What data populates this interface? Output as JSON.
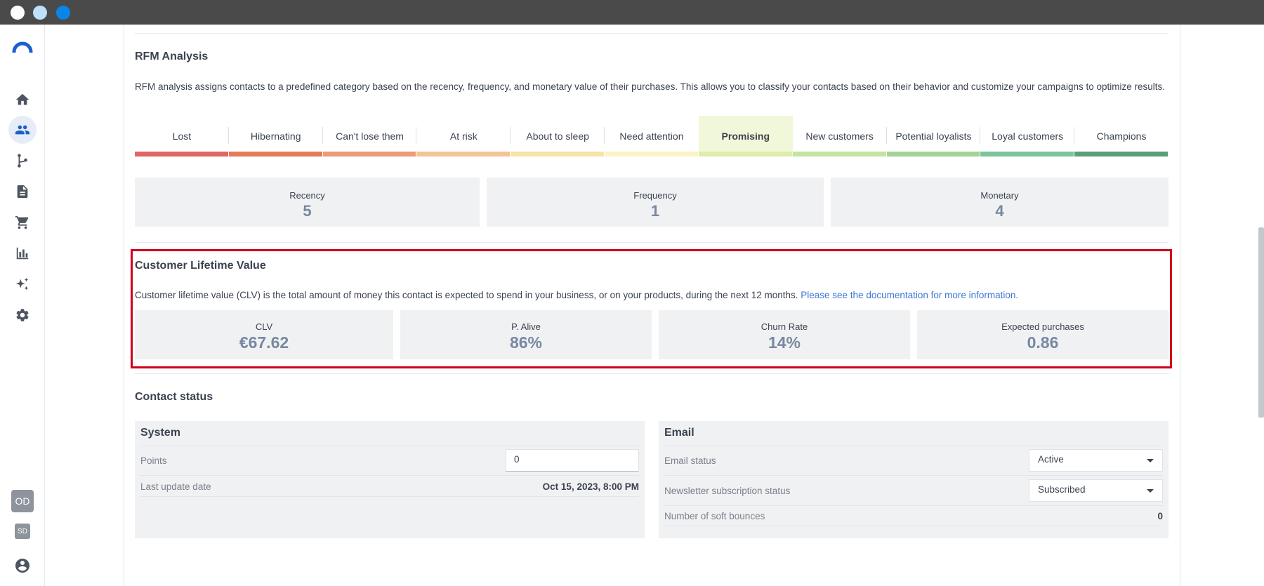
{
  "window": {
    "title_dots": [
      "close",
      "minimize",
      "maximize"
    ]
  },
  "sidebar": {
    "items": [
      {
        "icon": "home-icon",
        "active": false
      },
      {
        "icon": "contacts-icon",
        "active": true
      },
      {
        "icon": "workflow-icon",
        "active": false
      },
      {
        "icon": "document-icon",
        "active": false
      },
      {
        "icon": "cart-icon",
        "active": false
      },
      {
        "icon": "bar-chart-icon",
        "active": false
      },
      {
        "icon": "sparkles-icon",
        "active": false
      },
      {
        "icon": "gear-icon",
        "active": false
      }
    ],
    "avatars": {
      "primary": "OD",
      "secondary": "SD"
    },
    "account_icon": "account-circle-icon"
  },
  "rfm": {
    "title": "RFM Analysis",
    "description": "RFM analysis assigns contacts to a predefined category based on the recency, frequency, and monetary value of their purchases. This allows you to classify your contacts based on their behavior and customize your campaigns to optimize results.",
    "segments": [
      {
        "label": "Lost",
        "color": "#e06666"
      },
      {
        "label": "Hibernating",
        "color": "#e57a56"
      },
      {
        "label": "Can't lose them",
        "color": "#eb9a7a"
      },
      {
        "label": "At risk",
        "color": "#f3c496"
      },
      {
        "label": "About to sleep",
        "color": "#f8e3a8"
      },
      {
        "label": "Need attention",
        "color": "#fbf3c6"
      },
      {
        "label": "Promising",
        "color": "#dfedab"
      },
      {
        "label": "New customers",
        "color": "#c4e3a0"
      },
      {
        "label": "Potential loyalists",
        "color": "#a3d496"
      },
      {
        "label": "Loyal customers",
        "color": "#7ec49b"
      },
      {
        "label": "Champions",
        "color": "#5a9e7a"
      }
    ],
    "active_segment": "Promising",
    "scores": [
      {
        "label": "Recency",
        "value": "5"
      },
      {
        "label": "Frequency",
        "value": "1"
      },
      {
        "label": "Monetary",
        "value": "4"
      }
    ]
  },
  "clv": {
    "title": "Customer Lifetime Value",
    "description": "Customer lifetime value (CLV) is the total amount of money this contact is expected to spend in your business, or on your products, during the next 12 months.",
    "doc_link": "Please see the documentation for more information.",
    "metrics": [
      {
        "label": "CLV",
        "value": "€67.62"
      },
      {
        "label": "P. Alive",
        "value": "86%"
      },
      {
        "label": "Churn Rate",
        "value": "14%"
      },
      {
        "label": "Expected purchases",
        "value": "0.86"
      }
    ],
    "highlight_color": "#d0021b"
  },
  "contact_status": {
    "title": "Contact status",
    "system": {
      "title": "System",
      "points_label": "Points",
      "points_value": "0",
      "last_update_label": "Last update date",
      "last_update_value": "Oct 15, 2023, 8:00 PM"
    },
    "email": {
      "title": "Email",
      "email_status_label": "Email status",
      "email_status_value": "Active",
      "newsletter_label": "Newsletter subscription status",
      "newsletter_value": "Subscribed",
      "soft_bounces_label": "Number of soft bounces",
      "soft_bounces_value": "0"
    }
  }
}
